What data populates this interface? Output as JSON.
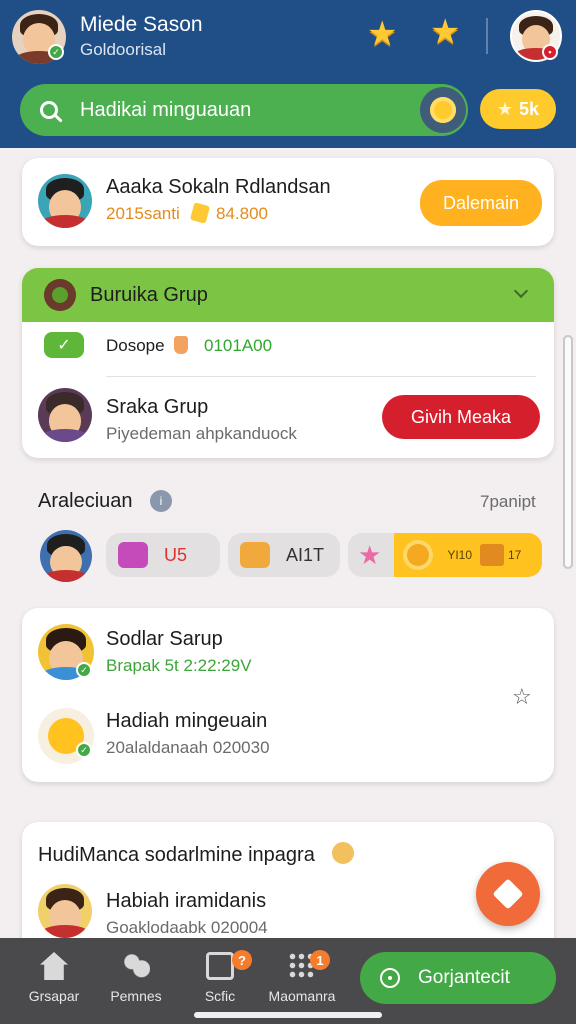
{
  "header": {
    "user_name": "Miede Sason",
    "user_sub": "Goldoorisal",
    "search_text": "Hadikai minguauan",
    "coin_label": "5k"
  },
  "cards": {
    "top": {
      "name": "Aaaka Sokaln Rdlandsan",
      "meta_left": "2015santi",
      "meta_right": "84.800",
      "button": "Dalemain"
    },
    "group": {
      "title": "Buruika Grup",
      "status_label": "Dosope",
      "status_value": "0101A00",
      "member_name": "Sraka Grup",
      "member_sub": "Piyedeman ahpkanduock",
      "button": "Givih Meaka"
    }
  },
  "activity": {
    "title": "Araleciuan",
    "right_label": "7panipt",
    "gifts": [
      {
        "label": "U5"
      },
      {
        "label": "AI1T"
      },
      {
        "label": "YI10",
        "value": "17"
      }
    ]
  },
  "feed": {
    "item1": {
      "name": "Sodlar Sarup",
      "sub": "Brapak 5t 2:22:29V"
    },
    "item2": {
      "name": "Hadiah mingeuain",
      "sub": "20alaldanaah 020030"
    }
  },
  "promo": {
    "title": "HudiManca sodarlmine inpagra",
    "name": "Habiah iramidanis",
    "sub": "Goaklodaabk 020004"
  },
  "nav": {
    "items": [
      {
        "label": "Grsapar"
      },
      {
        "label": "Pemnes"
      },
      {
        "label": "Scfic",
        "badge": "?"
      },
      {
        "label": "Maomanra",
        "badge": "1"
      }
    ],
    "cta": "Gorjantecit"
  },
  "colors": {
    "header_bg": "#1f4f86",
    "green": "#4caf50",
    "orange": "#ffb11f",
    "red": "#d61f2c",
    "nav_bg": "#4a4a4c"
  }
}
